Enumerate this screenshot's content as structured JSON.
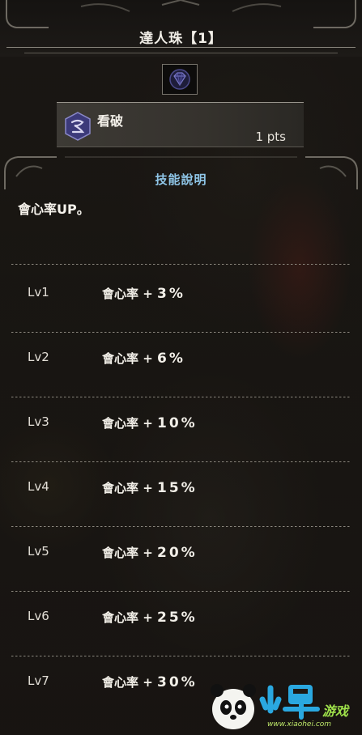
{
  "header": {
    "title": "達人珠【1】"
  },
  "decoration": {
    "slot_icon": "jewel-gem-icon"
  },
  "skill": {
    "name": "看破",
    "points": "1 pts",
    "icon": "critical-eye-skill-icon",
    "icon_color": "#3c3a7a"
  },
  "section": {
    "title": "技能說明",
    "color": "#8fc6e8"
  },
  "description": "會心率UP。",
  "levels": [
    {
      "label": "Lv1",
      "effect": "會心率 + ",
      "value": "3%"
    },
    {
      "label": "Lv2",
      "effect": "會心率 + ",
      "value": "6%"
    },
    {
      "label": "Lv3",
      "effect": "會心率 + ",
      "value": "10%"
    },
    {
      "label": "Lv4",
      "effect": "會心率 + ",
      "value": "15%"
    },
    {
      "label": "Lv5",
      "effect": "會心率 + ",
      "value": "20%"
    },
    {
      "label": "Lv6",
      "effect": "會心率 + ",
      "value": "25%"
    },
    {
      "label": "Lv7",
      "effect": "會心率 + ",
      "value": "30%"
    }
  ],
  "watermark": {
    "logo": "panda-logo",
    "text": "www.xiaohei.com"
  }
}
